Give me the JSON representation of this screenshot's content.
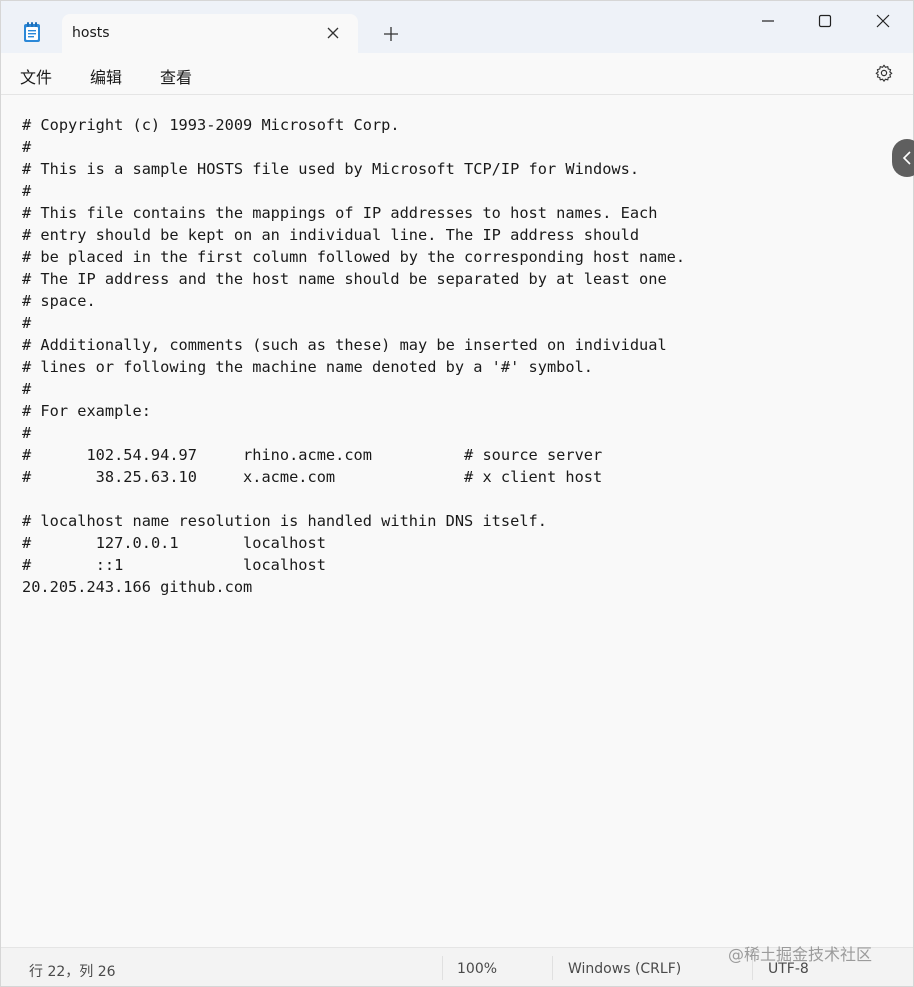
{
  "titlebar": {
    "tab_title": "hosts",
    "new_tab_label": "+"
  },
  "menu": {
    "file": "文件",
    "edit": "编辑",
    "view": "查看"
  },
  "editor": {
    "lines": [
      "# Copyright (c) 1993-2009 Microsoft Corp.",
      "#",
      "# This is a sample HOSTS file used by Microsoft TCP/IP for Windows.",
      "#",
      "# This file contains the mappings of IP addresses to host names. Each",
      "# entry should be kept on an individual line. The IP address should",
      "# be placed in the first column followed by the corresponding host name.",
      "# The IP address and the host name should be separated by at least one",
      "# space.",
      "#",
      "# Additionally, comments (such as these) may be inserted on individual",
      "# lines or following the machine name denoted by a '#' symbol.",
      "#",
      "# For example:",
      "#",
      "#      102.54.94.97     rhino.acme.com          # source server",
      "#       38.25.63.10     x.acme.com              # x client host",
      "",
      "# localhost name resolution is handled within DNS itself.",
      "#\t127.0.0.1       localhost",
      "#\t::1             localhost",
      "20.205.243.166 github.com"
    ]
  },
  "status": {
    "position": "行 22，列 26",
    "zoom": "100%",
    "line_ending": "Windows (CRLF)",
    "encoding": "UTF-8"
  },
  "watermark": "@稀土掘金技术社区",
  "icons": {
    "app": "notepad-icon",
    "close_tab": "close-icon",
    "new_tab": "plus-icon",
    "minimize": "minimize-icon",
    "maximize": "maximize-icon",
    "close_window": "close-icon",
    "settings": "gear-icon",
    "side": "chevron-left-icon"
  },
  "colors": {
    "titlebar_bg": "#eef2f8",
    "editor_bg": "#f9f9f9",
    "accent": "#2b88d8"
  }
}
